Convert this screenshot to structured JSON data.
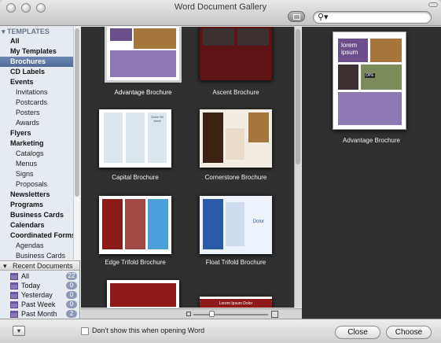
{
  "window": {
    "title": "Word Document Gallery"
  },
  "search": {
    "placeholder": "",
    "value": "",
    "icon": "magnifier-dropdown-icon"
  },
  "sidebar": {
    "section_label": "TEMPLATES",
    "items": [
      {
        "label": "All",
        "kind": "top"
      },
      {
        "label": "My Templates",
        "kind": "top"
      },
      {
        "label": "Brochures",
        "kind": "top",
        "selected": true
      },
      {
        "label": "CD Labels",
        "kind": "top"
      },
      {
        "label": "Events",
        "kind": "top"
      },
      {
        "label": "Invitations",
        "kind": "sub"
      },
      {
        "label": "Postcards",
        "kind": "sub"
      },
      {
        "label": "Posters",
        "kind": "sub"
      },
      {
        "label": "Awards",
        "kind": "sub"
      },
      {
        "label": "Flyers",
        "kind": "top"
      },
      {
        "label": "Marketing",
        "kind": "top"
      },
      {
        "label": "Catalogs",
        "kind": "sub"
      },
      {
        "label": "Menus",
        "kind": "sub"
      },
      {
        "label": "Signs",
        "kind": "sub"
      },
      {
        "label": "Proposals",
        "kind": "sub"
      },
      {
        "label": "Newsletters",
        "kind": "top"
      },
      {
        "label": "Programs",
        "kind": "top"
      },
      {
        "label": "Business Cards",
        "kind": "top"
      },
      {
        "label": "Calendars",
        "kind": "top"
      },
      {
        "label": "Coordinated Forms",
        "kind": "top"
      },
      {
        "label": "Agendas",
        "kind": "sub"
      },
      {
        "label": "Business Cards",
        "kind": "sub"
      }
    ]
  },
  "recent": {
    "header": "Recent Documents",
    "items": [
      {
        "label": "All",
        "count": "22"
      },
      {
        "label": "Today",
        "count": "0"
      },
      {
        "label": "Yesterday",
        "count": "0"
      },
      {
        "label": "Past Week",
        "count": "0"
      },
      {
        "label": "Past Month",
        "count": "2"
      }
    ]
  },
  "gallery": {
    "templates": [
      {
        "name": "Advantage Brochure",
        "selected": true
      },
      {
        "name": "Ascent Brochure"
      },
      {
        "name": "Capital Brochure"
      },
      {
        "name": "Cornerstone Brochure"
      },
      {
        "name": "Edge Trifold Brochure"
      },
      {
        "name": "Float Trifold Brochure"
      }
    ],
    "thumb_text": {
      "lorem": "lorem",
      "ipsum": "ipsum",
      "dolor_sit_amet": "Dolor Sit Amet",
      "lorem_ipsum_dolor": "Lorem Ipsum Dolor",
      "dolor": "Dolor",
      "ope": "OPE"
    }
  },
  "preview": {
    "title": "Advantage Brochure",
    "heading1": "lorem",
    "heading2": "ipsum"
  },
  "footer": {
    "checkbox_label": "Don't show this when opening Word",
    "checkbox_checked": false,
    "close_label": "Close",
    "choose_label": "Choose"
  },
  "colors": {
    "accent_purple": "#6a4f8a",
    "selection_blue": "#5a75a6",
    "gallery_bg": "#303030"
  }
}
